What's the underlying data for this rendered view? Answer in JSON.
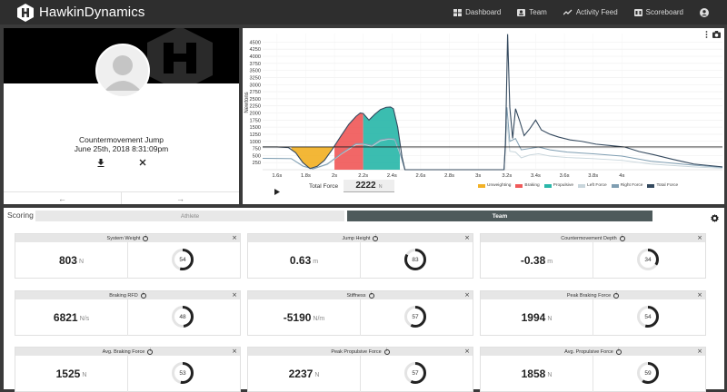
{
  "app": {
    "brand": "HawkinDynamics"
  },
  "nav": [
    {
      "label": "Dashboard",
      "icon": "dashboard-icon"
    },
    {
      "label": "Team",
      "icon": "team-icon"
    },
    {
      "label": "Activity Feed",
      "icon": "activity-icon"
    },
    {
      "label": "Scoreboard",
      "icon": "scoreboard-icon"
    }
  ],
  "profile": {
    "test_name": "Countermovement Jump",
    "date": "June 25th, 2018 8:31:09pm",
    "prev_label": "←",
    "next_label": "→"
  },
  "chart_toolbar": {
    "total_label": "Total Force",
    "total_value": "2222",
    "total_unit": "N"
  },
  "chart_data": {
    "type": "line",
    "ylabel": "Newtons",
    "ylim": [
      0,
      4800
    ],
    "y_ticks": [
      250,
      500,
      750,
      1000,
      1250,
      1500,
      1750,
      2000,
      2250,
      2500,
      2750,
      3000,
      3250,
      3500,
      3750,
      4000,
      4250,
      4500
    ],
    "xlim": [
      1.5,
      4.7
    ],
    "x_ticks": [
      "1.6s",
      "1.8s",
      "2s",
      "2.2s",
      "2.4s",
      "2.6s",
      "2.8s",
      "3s",
      "3.2s",
      "3.4s",
      "3.6s",
      "3.8s",
      "4s"
    ],
    "x_tick_values": [
      1.6,
      1.8,
      2.0,
      2.2,
      2.4,
      2.6,
      2.8,
      3.0,
      3.2,
      3.4,
      3.6,
      3.8,
      4.0
    ],
    "body_weight": 803,
    "legend": [
      {
        "name": "Unweighting",
        "color": "#f2b126"
      },
      {
        "name": "Braking",
        "color": "#f05a5a"
      },
      {
        "name": "Propulsive",
        "color": "#2ab7a9"
      },
      {
        "name": "Left Force",
        "color": "#c9d6dc"
      },
      {
        "name": "Right Force",
        "color": "#7f9eb2"
      },
      {
        "name": "Total Force",
        "color": "#34495e"
      }
    ],
    "total_force": [
      [
        1.5,
        803
      ],
      [
        1.6,
        803
      ],
      [
        1.68,
        780
      ],
      [
        1.73,
        600
      ],
      [
        1.78,
        250
      ],
      [
        1.83,
        40
      ],
      [
        1.88,
        120
      ],
      [
        1.93,
        330
      ],
      [
        1.98,
        680
      ],
      [
        2.04,
        1150
      ],
      [
        2.1,
        1600
      ],
      [
        2.15,
        1880
      ],
      [
        2.18,
        2000
      ],
      [
        2.2,
        1980
      ],
      [
        2.24,
        1750
      ],
      [
        2.28,
        1950
      ],
      [
        2.32,
        2120
      ],
      [
        2.36,
        2200
      ],
      [
        2.39,
        2210
      ],
      [
        2.41,
        2150
      ],
      [
        2.44,
        1500
      ],
      [
        2.47,
        450
      ],
      [
        2.49,
        0
      ],
      [
        3.18,
        0
      ],
      [
        3.19,
        900
      ],
      [
        3.205,
        4780
      ],
      [
        3.22,
        2200
      ],
      [
        3.24,
        1100
      ],
      [
        3.26,
        2150
      ],
      [
        3.29,
        1700
      ],
      [
        3.32,
        1200
      ],
      [
        3.36,
        1450
      ],
      [
        3.4,
        1750
      ],
      [
        3.44,
        1400
      ],
      [
        3.5,
        1250
      ],
      [
        3.56,
        1150
      ],
      [
        3.64,
        1050
      ],
      [
        3.72,
        1000
      ],
      [
        3.82,
        900
      ],
      [
        3.92,
        850
      ],
      [
        4.02,
        800
      ],
      [
        4.12,
        640
      ],
      [
        4.22,
        530
      ],
      [
        4.35,
        370
      ],
      [
        4.5,
        200
      ],
      [
        4.7,
        100
      ]
    ],
    "right_force": [
      [
        1.5,
        400
      ],
      [
        1.7,
        390
      ],
      [
        1.78,
        130
      ],
      [
        1.85,
        30
      ],
      [
        1.95,
        200
      ],
      [
        2.05,
        580
      ],
      [
        2.15,
        920
      ],
      [
        2.2,
        920
      ],
      [
        2.26,
        860
      ],
      [
        2.32,
        1060
      ],
      [
        2.38,
        1100
      ],
      [
        2.42,
        1080
      ],
      [
        2.45,
        700
      ],
      [
        2.49,
        0
      ],
      [
        3.18,
        0
      ],
      [
        3.2,
        2200
      ],
      [
        3.22,
        1000
      ],
      [
        3.26,
        1100
      ],
      [
        3.3,
        700
      ],
      [
        3.36,
        750
      ],
      [
        3.42,
        800
      ],
      [
        3.5,
        700
      ],
      [
        3.62,
        620
      ],
      [
        3.8,
        560
      ],
      [
        4.0,
        480
      ],
      [
        4.2,
        300
      ],
      [
        4.5,
        160
      ],
      [
        4.7,
        80
      ]
    ],
    "left_force": [
      [
        1.5,
        400
      ],
      [
        1.7,
        390
      ],
      [
        1.78,
        120
      ],
      [
        1.85,
        20
      ],
      [
        1.95,
        180
      ],
      [
        2.05,
        560
      ],
      [
        2.15,
        880
      ],
      [
        2.2,
        900
      ],
      [
        2.26,
        820
      ],
      [
        2.32,
        1020
      ],
      [
        2.38,
        1080
      ],
      [
        2.42,
        1060
      ],
      [
        2.45,
        650
      ],
      [
        2.49,
        0
      ],
      [
        3.18,
        0
      ],
      [
        3.2,
        1700
      ],
      [
        3.22,
        650
      ],
      [
        3.26,
        620
      ],
      [
        3.3,
        420
      ],
      [
        3.36,
        520
      ],
      [
        3.42,
        560
      ],
      [
        3.5,
        480
      ],
      [
        3.62,
        430
      ],
      [
        3.8,
        390
      ],
      [
        4.0,
        330
      ],
      [
        4.2,
        200
      ],
      [
        4.5,
        100
      ],
      [
        4.7,
        50
      ]
    ],
    "phases": [
      {
        "name": "Unweighting",
        "start": 1.7,
        "end": 2.0,
        "color": "#f2b126"
      },
      {
        "name": "Braking",
        "start": 2.0,
        "end": 2.2,
        "color": "#f05a5a"
      },
      {
        "name": "Propulsive",
        "start": 2.2,
        "end": 2.455,
        "color": "#2ab7a9"
      }
    ]
  },
  "scoring": {
    "title": "Scoring",
    "tab_athlete": "Athlete",
    "tab_team": "Team"
  },
  "metrics": [
    {
      "name": "System Weight",
      "value": "803",
      "unit": "N",
      "score": 54
    },
    {
      "name": "Jump Height",
      "value": "0.63",
      "unit": "m",
      "score": 83
    },
    {
      "name": "Countermovement Depth",
      "value": "-0.38",
      "unit": "m",
      "score": 34
    },
    {
      "name": "Braking RFD",
      "value": "6821",
      "unit": "N/s",
      "score": 48
    },
    {
      "name": "Stiffness",
      "value": "-5190",
      "unit": "N/m",
      "score": 57
    },
    {
      "name": "Peak Braking Force",
      "value": "1994",
      "unit": "N",
      "score": 54
    },
    {
      "name": "Avg. Braking Force",
      "value": "1525",
      "unit": "N",
      "score": 53
    },
    {
      "name": "Peak Propulsive Force",
      "value": "2237",
      "unit": "N",
      "score": 57
    },
    {
      "name": "Avg. Propulsive Force",
      "value": "1858",
      "unit": "N",
      "score": 59
    }
  ]
}
